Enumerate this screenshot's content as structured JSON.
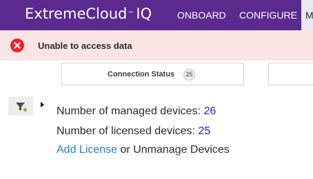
{
  "header": {
    "brand": {
      "name": "ExtremeCloud",
      "trademark": "™",
      "suffix": "IQ"
    },
    "nav": {
      "onboard": "ONBOARD",
      "configure": "CONFIGURE",
      "more_partial": "M"
    },
    "colors": {
      "background": "#5a2a8e",
      "text": "#ffffff"
    }
  },
  "alert": {
    "icon": "close-circle-icon",
    "message": "Unable to access data",
    "colors": {
      "background": "#fbe4e4",
      "icon": "#e5262c"
    }
  },
  "status_cards": [
    {
      "label": "Connection Status",
      "count": "25"
    }
  ],
  "filter": {
    "icon": "filter-icon",
    "indicator_color": "#6cbf4a",
    "expand_icon": "caret-right-icon"
  },
  "device_summary": {
    "managed_label": "Number of managed devices: ",
    "managed_count": "26",
    "licensed_label": "Number of licensed devices: ",
    "licensed_count": "25",
    "add_license_link": "Add License",
    "connector": " or ",
    "unmanage_text": "Unmanage Devices",
    "colors": {
      "count_link": "#1f1fd0",
      "action_link": "#1f7fc4"
    }
  }
}
